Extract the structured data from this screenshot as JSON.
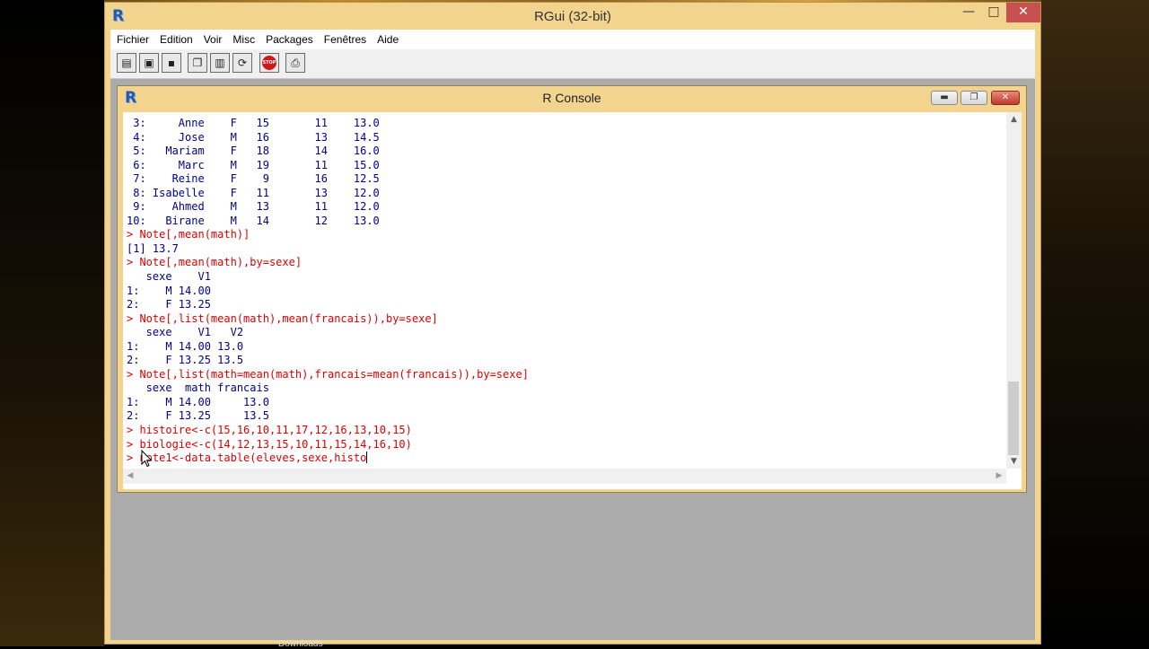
{
  "app": {
    "title": "RGui (32-bit)",
    "logo": "R",
    "window_controls": {
      "minimize": "—",
      "maximize": "□",
      "close": "✕"
    }
  },
  "menu": [
    "Fichier",
    "Edition",
    "Voir",
    "Misc",
    "Packages",
    "Fenêtres",
    "Aide"
  ],
  "toolbar": {
    "buttons": [
      {
        "name": "open-script-button",
        "icon": "folder-open-icon",
        "glyph": "📂"
      },
      {
        "name": "load-workspace-button",
        "icon": "load-icon",
        "glyph": "⇪"
      },
      {
        "name": "save-workspace-button",
        "icon": "floppy-icon",
        "glyph": "💾"
      },
      {
        "name": "copy-button",
        "icon": "copy-icon",
        "glyph": "⎘"
      },
      {
        "name": "paste-button",
        "icon": "clipboard-icon",
        "glyph": "📋"
      },
      {
        "name": "copy-paste-button",
        "icon": "refresh-icon",
        "glyph": "⟳"
      },
      {
        "name": "stop-button",
        "icon": "stop-icon",
        "glyph": "STOP"
      },
      {
        "name": "print-button",
        "icon": "printer-icon",
        "glyph": "🖶"
      }
    ]
  },
  "console": {
    "title": "R Console",
    "logo": "R",
    "controls": {
      "minimize": "▬",
      "maximize": "❐",
      "close": "✕"
    },
    "lines": [
      {
        "type": "out",
        "text": " 3:     Anne    F   15       11    13.0"
      },
      {
        "type": "out",
        "text": " 4:     Jose    M   16       13    14.5"
      },
      {
        "type": "out",
        "text": " 5:   Mariam    F   18       14    16.0"
      },
      {
        "type": "out",
        "text": " 6:     Marc    M   19       11    15.0"
      },
      {
        "type": "out",
        "text": " 7:    Reine    F    9       16    12.5"
      },
      {
        "type": "out",
        "text": " 8: Isabelle    F   11       13    12.0"
      },
      {
        "type": "out",
        "text": " 9:    Ahmed    M   13       11    12.0"
      },
      {
        "type": "out",
        "text": "10:   Birane    M   14       12    13.0"
      },
      {
        "type": "cmd",
        "text": "> Note[,mean(math)]"
      },
      {
        "type": "out",
        "text": "[1] 13.7"
      },
      {
        "type": "cmd",
        "text": "> Note[,mean(math),by=sexe]"
      },
      {
        "type": "out",
        "text": "   sexe    V1"
      },
      {
        "type": "out",
        "text": "1:    M 14.00"
      },
      {
        "type": "out",
        "text": "2:    F 13.25"
      },
      {
        "type": "cmd",
        "text": "> Note[,list(mean(math),mean(francais)),by=sexe]"
      },
      {
        "type": "out",
        "text": "   sexe    V1   V2"
      },
      {
        "type": "out",
        "text": "1:    M 14.00 13.0"
      },
      {
        "type": "out",
        "text": "2:    F 13.25 13.5"
      },
      {
        "type": "cmd",
        "text": "> Note[,list(math=mean(math),francais=mean(francais)),by=sexe]"
      },
      {
        "type": "out",
        "text": "   sexe  math francais"
      },
      {
        "type": "out",
        "text": "1:    M 14.00     13.0"
      },
      {
        "type": "out",
        "text": "2:    F 13.25     13.5"
      },
      {
        "type": "cmd",
        "text": "> histoire<-c(15,16,10,11,17,12,16,13,10,15)"
      },
      {
        "type": "cmd",
        "text": "> biologie<-c(14,12,13,15,10,11,15,14,16,10)"
      }
    ],
    "input_line": "> note1<-data.table(eleves,sexe,histo"
  },
  "taskbar_hint": "Downloads",
  "colors": {
    "frame": "#f2d48f",
    "output_text": "#00008b",
    "command_text": "#dd0000",
    "mdi_background": "#ababab"
  }
}
